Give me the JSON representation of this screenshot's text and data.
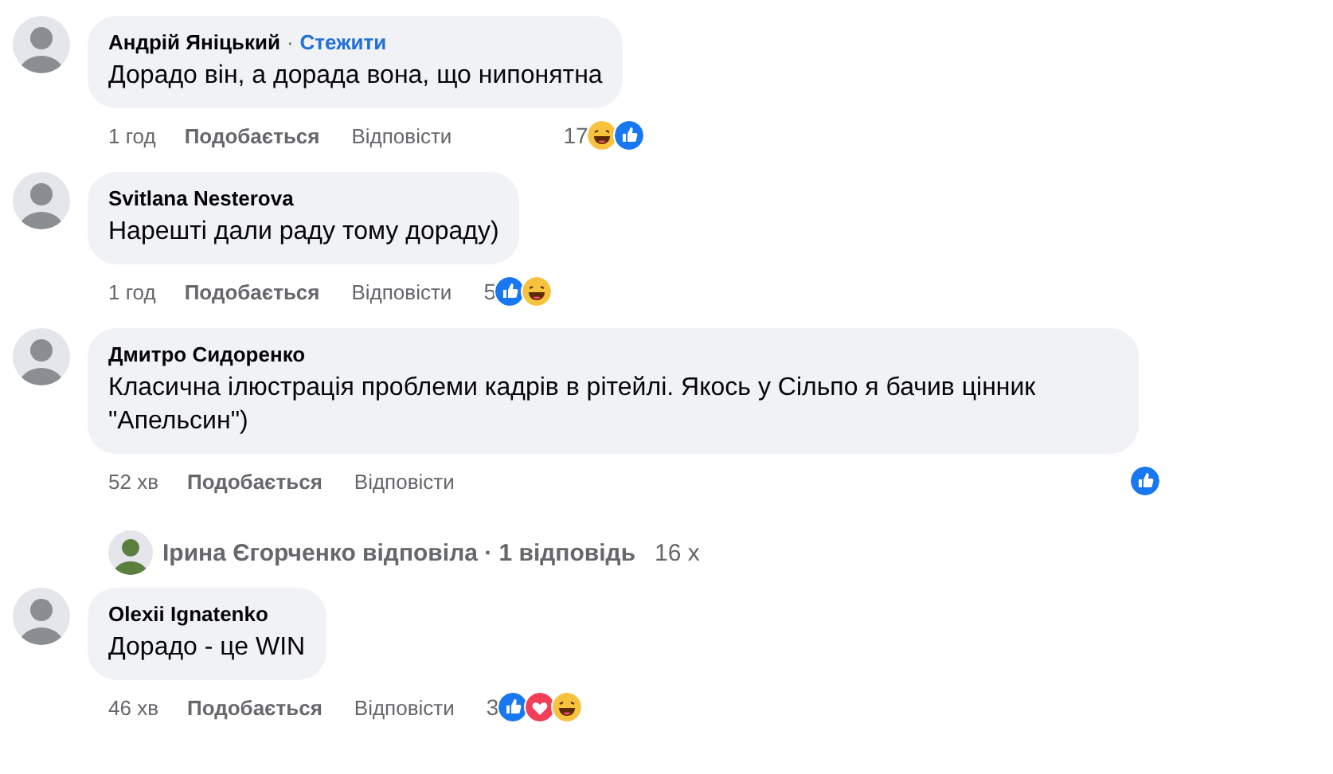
{
  "thread": [
    {
      "kind": "comment",
      "author": "Андрій Яніцький",
      "separator": "·",
      "follow": "Стежити",
      "text": "Дорадо він, а дорада вона, що нипонятна",
      "time": "1 год",
      "like": "Подобається",
      "reply": "Відповісти",
      "reaction_count": "17",
      "reactions": [
        {
          "kind": "haha"
        },
        {
          "kind": "like"
        }
      ]
    },
    {
      "kind": "comment",
      "author": "Svitlana Nesterova",
      "text": "Нарешті дали раду тому дораду)",
      "time": "1 год",
      "like": "Подобається",
      "reply": "Відповісти",
      "reaction_count": "5",
      "reactions": [
        {
          "kind": "like"
        },
        {
          "kind": "haha"
        }
      ]
    },
    {
      "kind": "comment",
      "author": "Дмитро Сидоренко",
      "text": "Класична ілюстрація проблеми кадрів в рітейлі. Якось у Сільпо я бачив цінник \"Апельсин\")",
      "time": "52 хв",
      "like": "Подобається",
      "reply": "Відповісти",
      "reactions": [
        {
          "kind": "like"
        }
      ]
    },
    {
      "kind": "replies",
      "text": "Ірина Єгорченко відповіла · 1 відповідь",
      "time": "16 х"
    },
    {
      "kind": "comment",
      "author": "Olexii Ignatenko",
      "text": "Дорадо - це WIN",
      "time": "46 хв",
      "like": "Подобається",
      "reply": "Відповісти",
      "reaction_count": "3",
      "reactions": [
        {
          "kind": "like"
        },
        {
          "kind": "love"
        },
        {
          "kind": "haha"
        }
      ]
    }
  ]
}
